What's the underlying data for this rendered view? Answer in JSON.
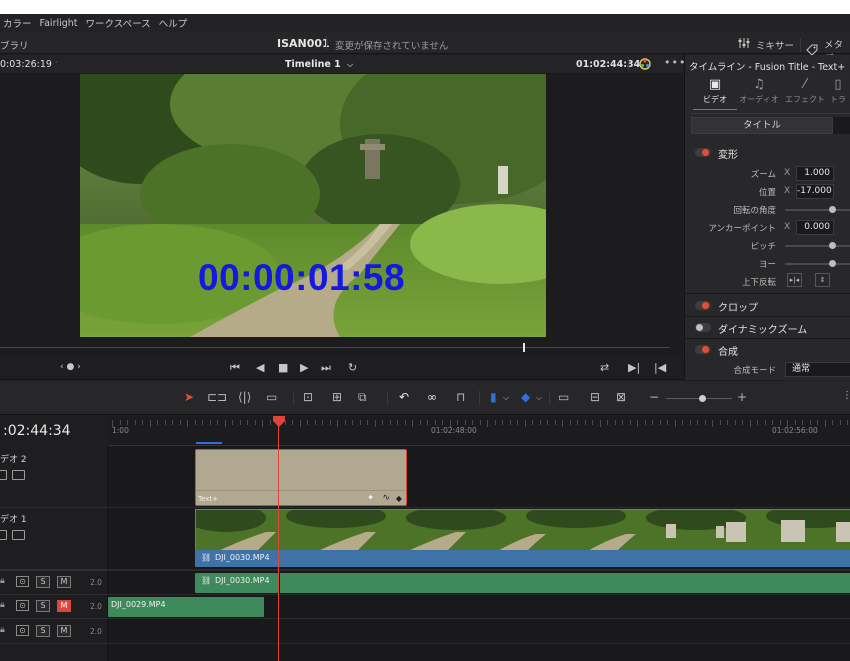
{
  "menubar": {
    "items": [
      "カラー",
      "Fairlight",
      "ワークスペース",
      "ヘルプ"
    ]
  },
  "titlebar": {
    "left_label": "ブラリ",
    "project_title": "ISAN001",
    "save_status": "変更が保存されていません",
    "mixer_label": "ミキサー",
    "metadata_label": "メタデー"
  },
  "viewer": {
    "timecode_left": "0:03:26:19",
    "timeline_name": "Timeline 1",
    "timecode_right": "01:02:44:34",
    "overlay_timecode": "00:00:01:58"
  },
  "inspector": {
    "title": "タイムライン - Fusion Title - Text+",
    "tabs": [
      {
        "label": "ビデオ",
        "icon": "video-icon"
      },
      {
        "label": "オーディオ",
        "icon": "music-note-icon"
      },
      {
        "label": "エフェクト",
        "icon": "magic-wand-icon"
      },
      {
        "label": "トラ",
        "icon": "transition-icon"
      }
    ],
    "subtab": "タイトル",
    "transform": {
      "label": "変形",
      "zoom_label": "ズーム",
      "zoom_axis": "X",
      "zoom_value": "1.000",
      "position_label": "位置",
      "position_axis": "X",
      "position_value": "-17.000",
      "rotation_label": "回転の角度",
      "anchor_label": "アンカーポイント",
      "anchor_axis": "X",
      "anchor_value": "0.000",
      "pitch_label": "ピッチ",
      "yaw_label": "ヨー",
      "flip_label": "上下反転"
    },
    "crop_label": "クロップ",
    "dynamic_zoom_label": "ダイナミックズーム",
    "composite": {
      "label": "合成",
      "mode_label": "合成モード",
      "mode_value": "通常"
    }
  },
  "timeline": {
    "timecode": ":02:44:34",
    "ruler_labels": [
      "1:00",
      "01:02:48:00",
      "01:02:56:00"
    ],
    "tracks": {
      "video2_label": "デオ 2",
      "video1_label": "デオ 1",
      "audio_s": "S",
      "audio_m": "M",
      "audio_level": "2.0"
    },
    "clips": {
      "title_clip": "Text+",
      "video1_clip": "DJI_0030.MP4",
      "audio1_clip": "DJI_0030.MP4",
      "audio2_clip": "DJI_0029.MP4"
    }
  },
  "colors": {
    "accent_red": "#e64b3c",
    "overlay_text": "#1418e0",
    "audio_clip": "#3f8a5c",
    "video_clip_bar": "#3f73a8",
    "title_clip": "#b1a892"
  }
}
